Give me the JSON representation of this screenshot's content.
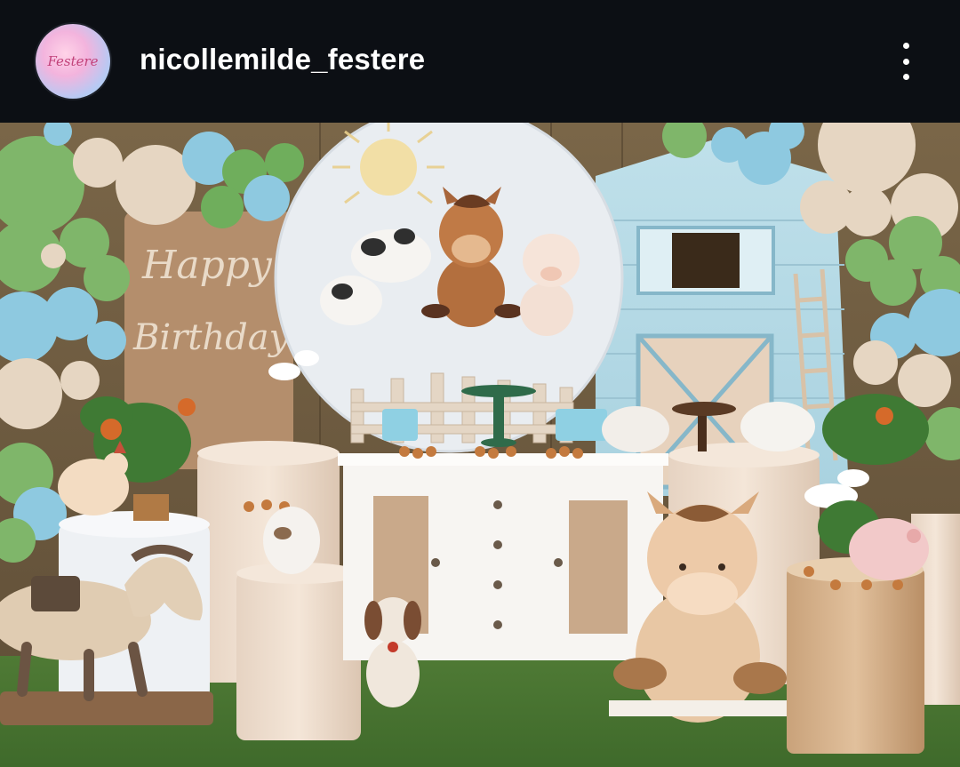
{
  "header": {
    "username": "nicollemilde_festere",
    "avatar_text": "Festere",
    "menu_icon": "more-vertical-icon"
  },
  "photo": {
    "banner_text": "Happy Birthday"
  },
  "colors": {
    "header_bg": "#0c0f14",
    "username": "#ffffff"
  }
}
